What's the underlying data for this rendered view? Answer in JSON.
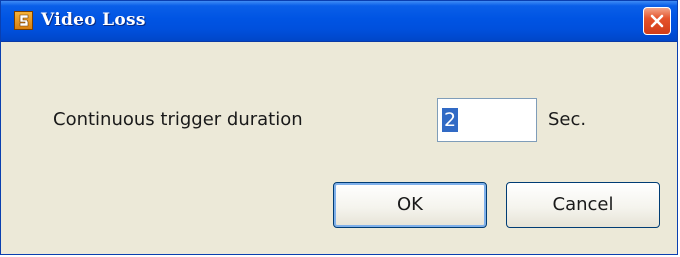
{
  "window": {
    "title": "Video Loss",
    "icon": "app-icon",
    "close_icon": "close-icon"
  },
  "form": {
    "label": "Continuous trigger duration",
    "duration_value": "2",
    "unit": "Sec."
  },
  "buttons": {
    "ok_label": "OK",
    "cancel_label": "Cancel"
  },
  "colors": {
    "titlebar": "#0054e3",
    "dialog_bg": "#ece9d8",
    "close_button": "#e5532c",
    "selection": "#316ac5"
  }
}
